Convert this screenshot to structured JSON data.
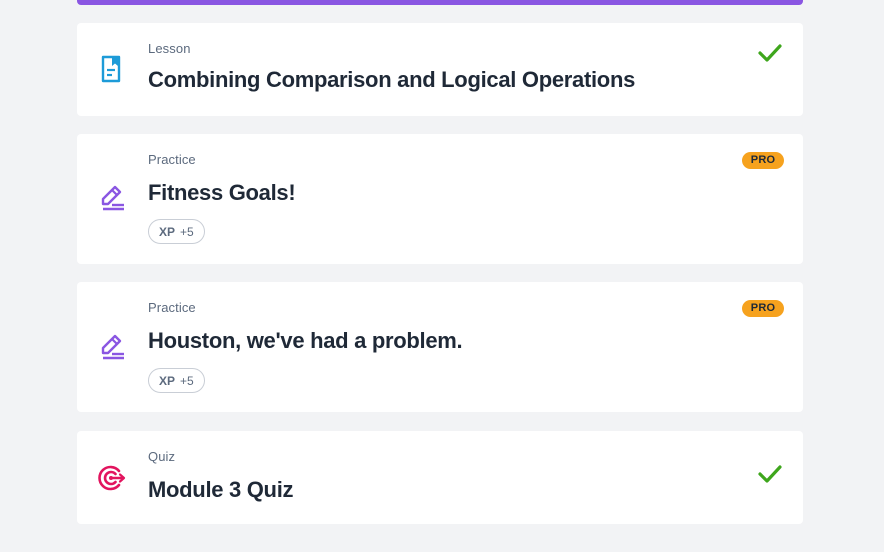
{
  "colors": {
    "accent_bar": "#8a56e2",
    "lesson_icon": "#1d9bd8",
    "practice_icon": "#8a56e2",
    "quiz_icon": "#e2145e",
    "check": "#3ea61c",
    "pro_badge": "#f6a21e"
  },
  "items": [
    {
      "type": "Lesson",
      "title": "Combining Comparison and Logical Operations",
      "icon": "lesson-document-icon",
      "completed": true
    },
    {
      "type": "Practice",
      "title": "Fitness Goals!",
      "icon": "practice-pencil-icon",
      "badge": "PRO",
      "xp_label": "XP",
      "xp_value": "+5"
    },
    {
      "type": "Practice",
      "title": "Houston, we've had a problem.",
      "icon": "practice-pencil-icon",
      "badge": "PRO",
      "xp_label": "XP",
      "xp_value": "+5"
    },
    {
      "type": "Quiz",
      "title": "Module 3 Quiz",
      "icon": "quiz-target-icon",
      "completed": true
    }
  ]
}
